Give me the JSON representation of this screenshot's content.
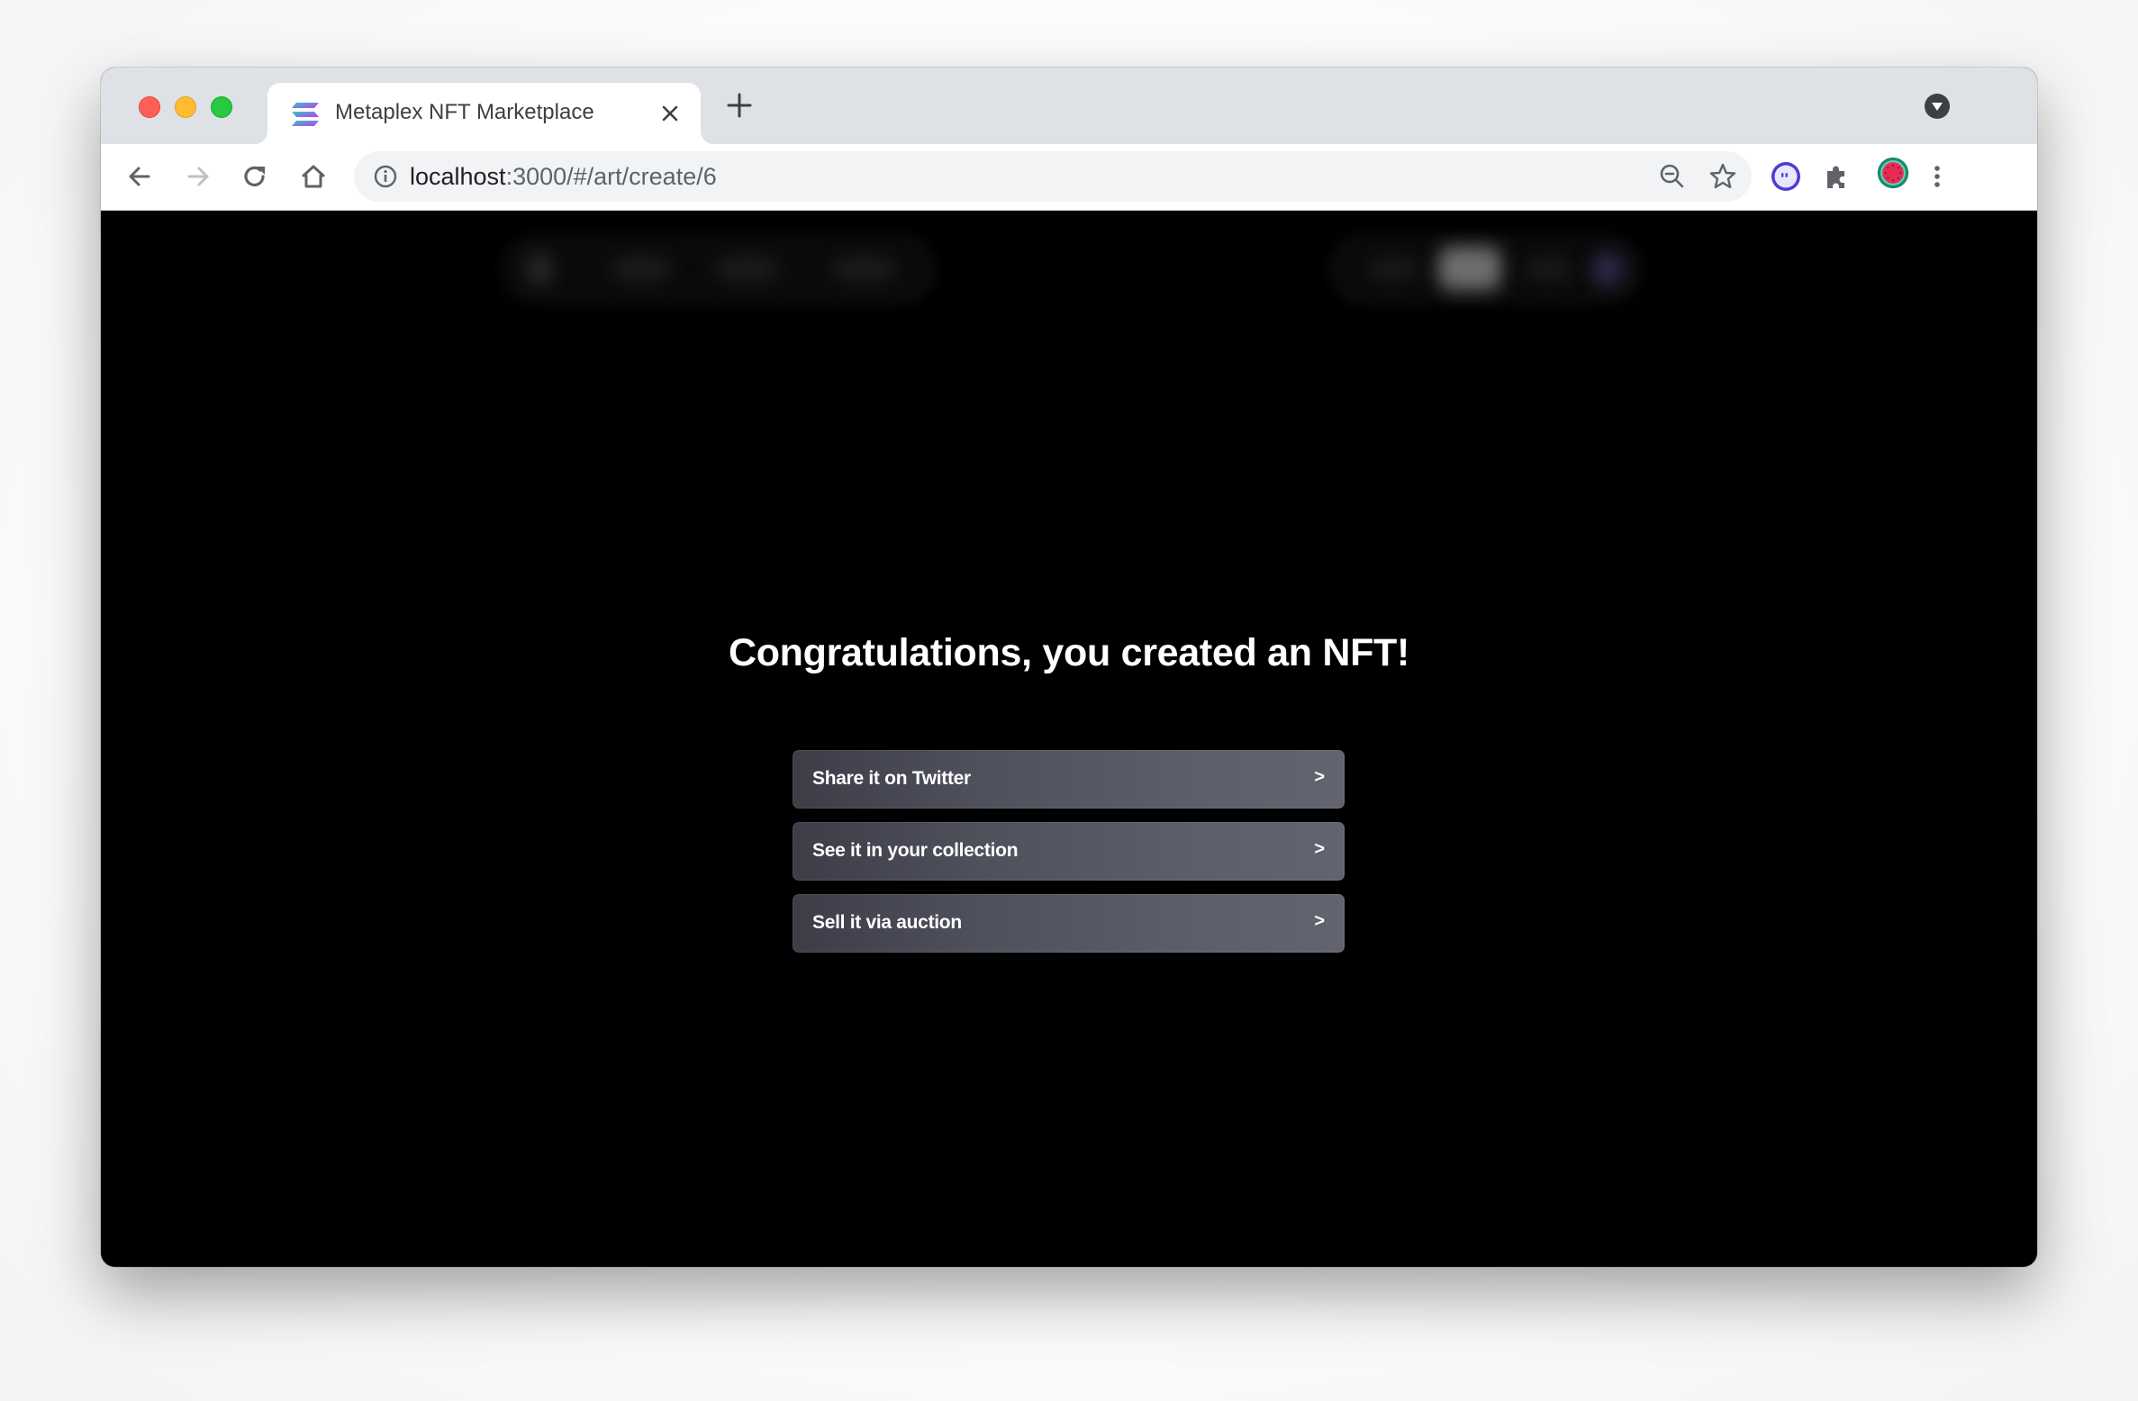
{
  "browser": {
    "tab": {
      "title": "Metaplex NFT Marketplace",
      "favicon": "solana-logo-icon",
      "close_icon": "close-icon"
    },
    "new_tab_icon": "plus-icon",
    "tab_search_icon": "chevron-down-circle-icon",
    "nav": {
      "back_icon": "arrow-left-icon",
      "forward_icon": "arrow-right-icon",
      "reload_icon": "reload-icon",
      "home_icon": "home-icon"
    },
    "address_bar": {
      "info_icon": "info-icon",
      "url_host": "localhost",
      "url_path": ":3000/#/art/create/6",
      "zoom_icon": "zoom-out-icon",
      "bookmark_icon": "star-icon"
    },
    "extensions": [
      {
        "name": "phantom-wallet-icon"
      },
      {
        "name": "puzzle-extensions-icon"
      }
    ],
    "profile_icon": "watermelon-avatar-icon",
    "menu_icon": "kebab-menu-icon"
  },
  "page": {
    "heading": "Congratulations, you created an NFT!",
    "actions": [
      {
        "label": "Share it on Twitter",
        "arrow": ">"
      },
      {
        "label": "See it in your collection",
        "arrow": ">"
      },
      {
        "label": "Sell it via auction",
        "arrow": ">"
      }
    ]
  },
  "colors": {
    "background": "#000000",
    "button_gradient_start": "#3d3d48",
    "button_gradient_end": "#62656f",
    "text": "#ffffff"
  }
}
